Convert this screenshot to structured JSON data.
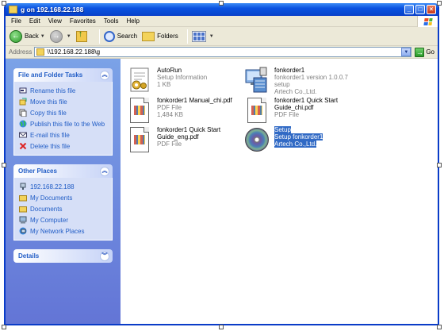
{
  "window": {
    "title": "g on 192.168.22.188",
    "minimize": "_",
    "maximize": "□",
    "close": "×"
  },
  "menu": [
    "File",
    "Edit",
    "View",
    "Favorites",
    "Tools",
    "Help"
  ],
  "toolbar": {
    "back_label": "Back",
    "search_label": "Search",
    "folders_label": "Folders"
  },
  "address": {
    "label": "Address",
    "value": "\\\\192.168.22.188\\g",
    "go_label": "Go"
  },
  "file_tasks": {
    "title": "File and Folder Tasks",
    "items": [
      {
        "label": "Rename this file",
        "icon": "rename-icon"
      },
      {
        "label": "Move this file",
        "icon": "move-icon"
      },
      {
        "label": "Copy this file",
        "icon": "copy-icon"
      },
      {
        "label": "Publish this file to the Web",
        "icon": "globe-icon"
      },
      {
        "label": "E-mail this file",
        "icon": "email-icon"
      },
      {
        "label": "Delete this file",
        "icon": "delete-icon"
      }
    ]
  },
  "other_places": {
    "title": "Other Places",
    "items": [
      {
        "label": "192.168.22.188",
        "icon": "network-computer-icon"
      },
      {
        "label": "My Documents",
        "icon": "folder-icon"
      },
      {
        "label": "Documents",
        "icon": "folder-icon"
      },
      {
        "label": "My Computer",
        "icon": "computer-icon"
      },
      {
        "label": "My Network Places",
        "icon": "network-places-icon"
      }
    ]
  },
  "details": {
    "title": "Details"
  },
  "files": [
    {
      "name": "AutoRun",
      "line2": "Setup Information",
      "line3": "1 KB",
      "icon": "autorun-icon",
      "selected": false
    },
    {
      "name": "fonkorder1",
      "line2": "fonkorder1 version 1.0.0.7 setup",
      "line3": "Artech Co.,Ltd.",
      "icon": "installer-icon",
      "selected": false
    },
    {
      "name": "fonkorder1 Manual_chi.pdf",
      "line2": "PDF File",
      "line3": "1,484 KB",
      "icon": "pdf-icon",
      "selected": false
    },
    {
      "name": "fonkorder1 Quick Start Guide_chi.pdf",
      "line2": "PDF File",
      "line3": "",
      "icon": "pdf-icon",
      "selected": false
    },
    {
      "name": "fonkorder1 Quick Start Guide_eng.pdf",
      "line2": "PDF File",
      "line3": "",
      "icon": "pdf-icon",
      "selected": false
    },
    {
      "name": "Setup",
      "line2": "Setup fonkorder1",
      "line3": "Artech Co.,Ltd.",
      "icon": "cd-icon",
      "selected": true
    }
  ]
}
